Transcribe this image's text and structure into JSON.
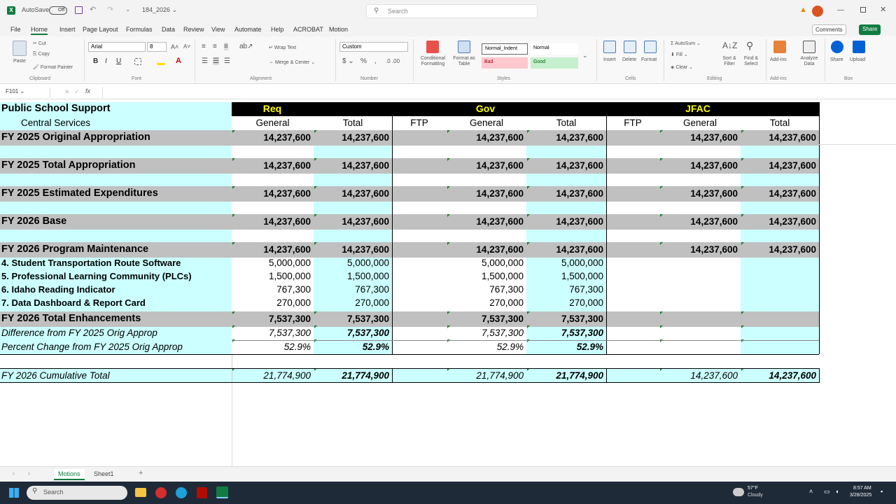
{
  "titlebar": {
    "autosave_label": "AutoSave",
    "toggle_label": "Off",
    "file_name": "184_2026",
    "search_placeholder": "Search"
  },
  "menu": [
    "File",
    "Home",
    "Insert",
    "Page Layout",
    "Formulas",
    "Data",
    "Review",
    "View",
    "Automate",
    "Help",
    "ACROBAT",
    "Motion"
  ],
  "actions": {
    "comments": "Comments",
    "share": "Share"
  },
  "ribbon": {
    "cut": "Cut",
    "copy": "Copy",
    "format_painter": "Format Painter",
    "paste": "Paste",
    "font_name": "Arial",
    "font_size": "8",
    "wrap_text": "Wrap Text",
    "merge_center": "Merge & Center",
    "number_format": "Custom",
    "conditional_formatting": "Conditional Formatting",
    "format_as_table": "Format as Table",
    "style_normal_indent": "Normal_Indent",
    "style_normal": "Normal",
    "style_bad": "Bad",
    "style_good": "Good",
    "insert": "Insert",
    "delete": "Delete",
    "format": "Format",
    "autosum": "AutoSum",
    "fill": "Fill",
    "clear": "Clear",
    "sort_filter": "Sort & Filter",
    "find_select": "Find & Select",
    "addins": "Add-ins",
    "analyze_data": "Analyze Data",
    "share": "Share",
    "upload": "Upload",
    "groups": [
      "Clipboard",
      "Font",
      "Alignment",
      "Number",
      "Styles",
      "Cells",
      "Editing",
      "Add-ins",
      "Box"
    ]
  },
  "formula_bar": {
    "name_box": "F101",
    "fx": "fx",
    "value": ""
  },
  "sheet": {
    "agency": "Public School Support",
    "program": "Central Services",
    "sections": {
      "req": "Req",
      "gov": "Gov",
      "jfac": "JFAC"
    },
    "col_headers": [
      "General",
      "Total",
      "FTP",
      "General",
      "Total",
      "FTP",
      "General",
      "Total"
    ],
    "rows": [
      {
        "label": "FY 2025 Original Appropriation",
        "vals": [
          "14,237,600",
          "14,237,600",
          "",
          "14,237,600",
          "14,237,600",
          "",
          "14,237,600",
          "14,237,600"
        ]
      },
      {
        "label": "FY 2025 Total Appropriation",
        "vals": [
          "14,237,600",
          "14,237,600",
          "",
          "14,237,600",
          "14,237,600",
          "",
          "14,237,600",
          "14,237,600"
        ]
      },
      {
        "label": "FY 2025 Estimated Expenditures",
        "vals": [
          "14,237,600",
          "14,237,600",
          "",
          "14,237,600",
          "14,237,600",
          "",
          "14,237,600",
          "14,237,600"
        ]
      },
      {
        "label": "FY 2026 Base",
        "vals": [
          "14,237,600",
          "14,237,600",
          "",
          "14,237,600",
          "14,237,600",
          "",
          "14,237,600",
          "14,237,600"
        ]
      },
      {
        "label": "FY 2026 Program Maintenance",
        "vals": [
          "14,237,600",
          "14,237,600",
          "",
          "14,237,600",
          "14,237,600",
          "",
          "14,237,600",
          "14,237,600"
        ]
      },
      {
        "label": "4. Student Transportation Route Software",
        "vals": [
          "5,000,000",
          "5,000,000",
          "",
          "5,000,000",
          "5,000,000",
          "",
          "",
          ""
        ]
      },
      {
        "label": "5. Professional Learning Community (PLCs)",
        "vals": [
          "1,500,000",
          "1,500,000",
          "",
          "1,500,000",
          "1,500,000",
          "",
          "",
          ""
        ]
      },
      {
        "label": "6. Idaho Reading Indicator",
        "vals": [
          "767,300",
          "767,300",
          "",
          "767,300",
          "767,300",
          "",
          "",
          ""
        ]
      },
      {
        "label": "7. Data Dashboard & Report Card",
        "vals": [
          "270,000",
          "270,000",
          "",
          "270,000",
          "270,000",
          "",
          "",
          ""
        ]
      },
      {
        "label": "FY 2026 Total Enhancements",
        "vals": [
          "7,537,300",
          "7,537,300",
          "",
          "7,537,300",
          "7,537,300",
          "",
          "",
          ""
        ]
      },
      {
        "label": "Difference from FY 2025 Orig Approp",
        "vals": [
          "7,537,300",
          "7,537,300",
          "",
          "7,537,300",
          "7,537,300",
          "",
          "",
          ""
        ]
      },
      {
        "label": "Percent Change from FY 2025 Orig Approp",
        "vals": [
          "52.9%",
          "52.9%",
          "",
          "52.9%",
          "52.9%",
          "",
          "",
          ""
        ]
      },
      {
        "label": "FY 2026 Cumulative Total",
        "vals": [
          "21,774,900",
          "21,774,900",
          "",
          "21,774,900",
          "21,774,900",
          "",
          "14,237,600",
          "14,237,600"
        ]
      }
    ]
  },
  "tabs": [
    "Motions",
    "Sheet1"
  ],
  "taskbar": {
    "search": "Search",
    "weather_temp": "57°F",
    "weather_desc": "Cloudy",
    "time": "8:57 AM",
    "date": "3/28/2025"
  },
  "colors": {
    "accent": "#107c41",
    "cyan": "#ccffff",
    "gray": "#c0c0c0",
    "header_yellow": "#ffff00"
  }
}
